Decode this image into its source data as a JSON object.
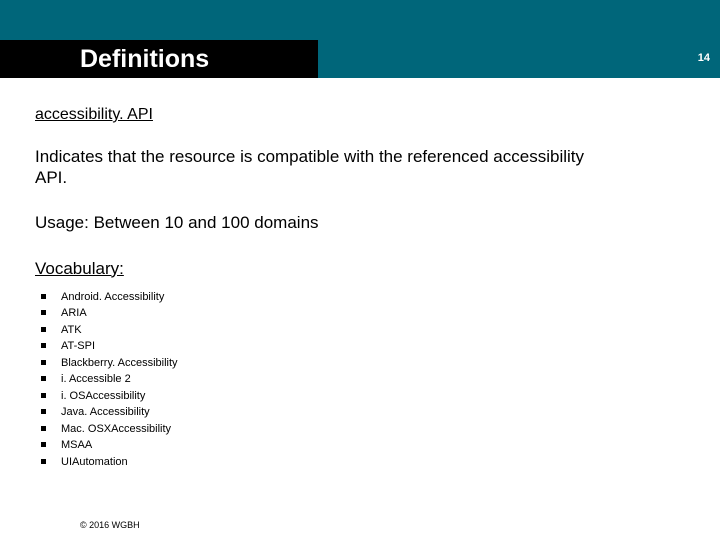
{
  "header": {
    "title": "Definitions",
    "page_number": "14"
  },
  "body": {
    "term": "accessibility. API",
    "description": "Indicates that the resource is compatible with the referenced accessibility API.",
    "usage": "Usage: Between 10 and 100 domains",
    "vocab_label": "Vocabulary:",
    "vocab_items": [
      "Android. Accessibility",
      "ARIA",
      "ATK",
      "AT-SPI",
      "Blackberry. Accessibility",
      "i. Accessible 2",
      "i. OSAccessibility",
      "Java. Accessibility",
      "Mac. OSXAccessibility",
      "MSAA",
      "UIAutomation"
    ]
  },
  "footer": {
    "copyright": "© 2016 WGBH"
  }
}
